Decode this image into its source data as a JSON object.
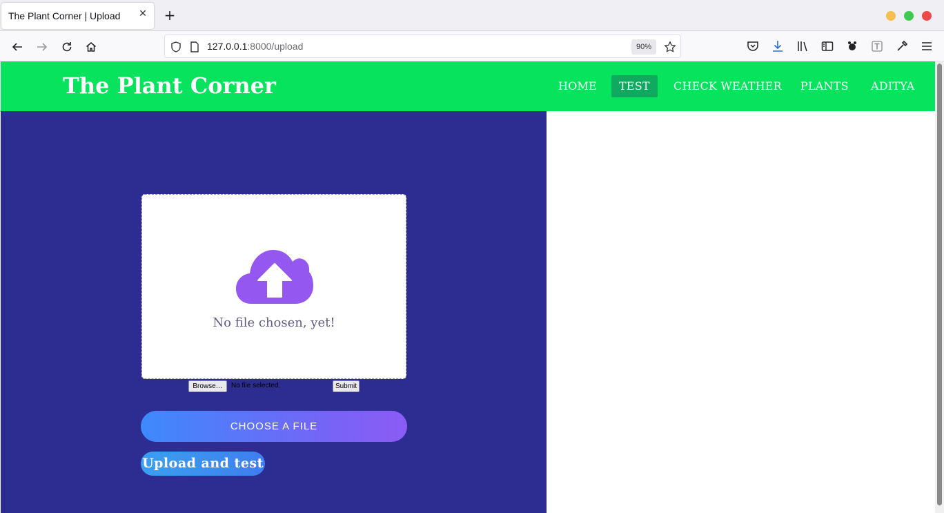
{
  "browser": {
    "tab_title": "The Plant Corner | Upload",
    "tab_close": "✕",
    "new_tab": "+",
    "url_host": "127.0.0.1",
    "url_rest": ":8000/upload",
    "zoom": "90%"
  },
  "site": {
    "brand": "The Plant Corner",
    "menu": [
      {
        "label": "HOME"
      },
      {
        "label": "TEST",
        "active": true
      },
      {
        "label": "CHECK WEATHER"
      },
      {
        "label": "PLANTS"
      },
      {
        "label": "ADITYA"
      }
    ]
  },
  "upload": {
    "status_text": "No file chosen, yet!",
    "browse_label": "Browse…",
    "file_status": "No file selected.",
    "submit_label": "Submit",
    "choose_label": "CHOOSE A FILE",
    "upload_test_label": "Upload and test"
  },
  "colors": {
    "header_bg": "#07e35d",
    "active_menu_bg": "#0fa960",
    "panel_bg": "#2d2c91",
    "cloud": "#9457f0"
  }
}
